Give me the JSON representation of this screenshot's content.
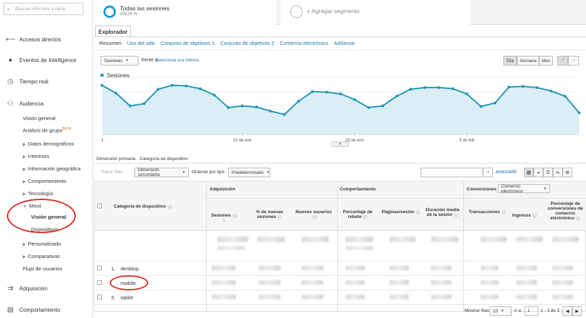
{
  "sidebar": {
    "search_placeholder": "Buscar informes y otros",
    "items": [
      {
        "label": "Accesos directos",
        "icon": "shortcut-icon"
      },
      {
        "label": "Eventos de Intelligence",
        "icon": "lightbulb-icon"
      },
      {
        "label": "Tiempo real",
        "icon": "clock-icon"
      },
      {
        "label": "Audiencia",
        "icon": "people-icon"
      }
    ],
    "audiencia_sub": {
      "vision_general": "Visión general",
      "analisis_grupo": "Análisis de grupo",
      "beta": "BETA",
      "datos_demograficos": "Datos demográficos",
      "intereses": "Intereses",
      "informacion_geografica": "Información geográfica",
      "comportamiento": "Comportamiento",
      "tecnologia": "Tecnología",
      "movil": "Móvil",
      "movil_vision_general": "Visión general",
      "dispositivos": "Dispositivos",
      "personalizado": "Personalizado",
      "comparativas": "Comparativas",
      "flujo_usuarios": "Flujo de usuarios"
    },
    "adquisicion": "Adquisición",
    "comportamiento_main": "Comportamiento"
  },
  "segments": {
    "all_sessions": "Todas las sesiones",
    "all_sessions_pct": "100,00 %",
    "add_segment": "+ Agregar segmento"
  },
  "tabs": {
    "explorador": "Explorador",
    "sub": [
      "Resumen",
      "Uso del sitio",
      "Conjunto de objetivos 1",
      "Conjunto de objetivos 2",
      "Comercio electrónico",
      "AdSense"
    ]
  },
  "controls": {
    "metric": "Sesiones",
    "vs": "frente a",
    "select_metric": "Selecciona una métrica",
    "dia": "Día",
    "semana": "Semana",
    "mes": "Mes"
  },
  "chart_data": {
    "type": "line",
    "series": [
      {
        "name": "Sesiones",
        "values": [
          86,
          72,
          50,
          54,
          79,
          86,
          85,
          80,
          69,
          47,
          50,
          48,
          41,
          35,
          58,
          75,
          74,
          71,
          61,
          47,
          50,
          67,
          79,
          82,
          82,
          80,
          71,
          49,
          55,
          83,
          84,
          82,
          76,
          67,
          38
        ]
      }
    ],
    "x_tick_labels": [
      "22 de ene",
      "29 de ene",
      "5 de feb"
    ],
    "x_tick_index": [
      10,
      18,
      26
    ],
    "series_color": "#2196b8",
    "fill_color": "#dbeef6",
    "ylim": [
      0,
      100
    ],
    "grid": true,
    "legend": "top-left"
  },
  "dimension": {
    "label": "Dimensión primaria:",
    "value": "Categoría de dispositivo"
  },
  "table_controls": {
    "trazar": "Trazar filas",
    "secondary": "Dimensión secundaria",
    "sort_label": "Ordenar por tipo:",
    "sort_value": "Predeterminado",
    "avanzado": "avanzado"
  },
  "table": {
    "dim_header": "Categoría de dispositivo",
    "groups": {
      "adquisicion": "Adquisición",
      "comportamiento": "Comportamiento",
      "conversiones": "Conversiones",
      "conv_select": "Comercio electrónico"
    },
    "cols": [
      "Sesiones",
      "% de nuevas sesiones",
      "Nuevos usuarios",
      "Porcentaje de rebote",
      "Páginas/sesión",
      "Duración media de la sesión",
      "Transacciones",
      "Ingresos",
      "Porcentaje de conversiones de comercio electrónico"
    ],
    "rows": [
      {
        "num": "1.",
        "name": "desktop"
      },
      {
        "num": "2.",
        "name": "mobile"
      },
      {
        "num": "3.",
        "name": "tablet"
      }
    ]
  },
  "pagination": {
    "show_rows": "Mostrar filas:",
    "rows_value": "10",
    "goto": "Ir a:",
    "goto_value": "1",
    "range": "1 - 3 de 3"
  }
}
